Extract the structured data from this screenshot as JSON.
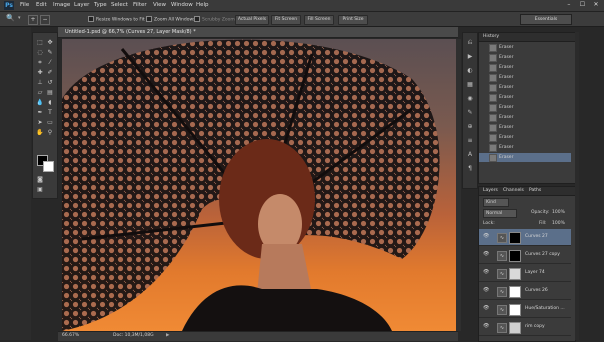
{
  "app": {
    "logo": "Ps",
    "menus": [
      "File",
      "Edit",
      "Image",
      "Layer",
      "Type",
      "Select",
      "Filter",
      "View",
      "Window",
      "Help"
    ],
    "window_controls": [
      "–",
      "☐",
      "✕"
    ]
  },
  "options_bar": {
    "resize_windows": "Resize Windows to Fit",
    "zoom_all": "Zoom All Windows",
    "scrubby_zoom": "Scrubby Zoom",
    "actual_pixels": "Actual Pixels",
    "fit_screen": "Fit Screen",
    "fill_screen": "Fill Screen",
    "print_size": "Print Size",
    "workspace": "Essentials"
  },
  "document": {
    "tab_title": "Untitled-1.psd @ 66,7% (Curves 27, Layer Mask/8) *",
    "zoom": "66.67%",
    "doc_size": "Doc: 10,3M/1,08G"
  },
  "history": {
    "tabs": [
      "History"
    ],
    "items": [
      "Eraser",
      "Eraser",
      "Eraser",
      "Eraser",
      "Eraser",
      "Eraser",
      "Eraser",
      "Eraser",
      "Eraser",
      "Eraser",
      "Eraser",
      "Eraser"
    ]
  },
  "layers": {
    "tabs": [
      "Layers",
      "Channels",
      "Paths"
    ],
    "kind": "Kind",
    "blend_mode": "Normal",
    "opacity_label": "Opacity:",
    "opacity": "100%",
    "lock_label": "Lock:",
    "fill_label": "Fill:",
    "fill": "100%",
    "rows": [
      {
        "name": "Curves 27",
        "thumb": "#000000",
        "selected": true
      },
      {
        "name": "Curves 27 copy",
        "thumb": "#000000",
        "selected": false
      },
      {
        "name": "Layer 74",
        "thumb": "#d9d9d9",
        "selected": false
      },
      {
        "name": "Curves 26",
        "thumb": "#ffffff",
        "selected": false
      },
      {
        "name": "Hue/Saturation ...",
        "thumb": "#ffffff",
        "selected": false
      },
      {
        "name": "rim copy",
        "thumb": "#cfcfcf",
        "selected": false
      }
    ]
  },
  "colors": {
    "canvas_top": "#5b4f52",
    "canvas_bottom": "#f08a35",
    "selection": "#5b6f8a"
  }
}
